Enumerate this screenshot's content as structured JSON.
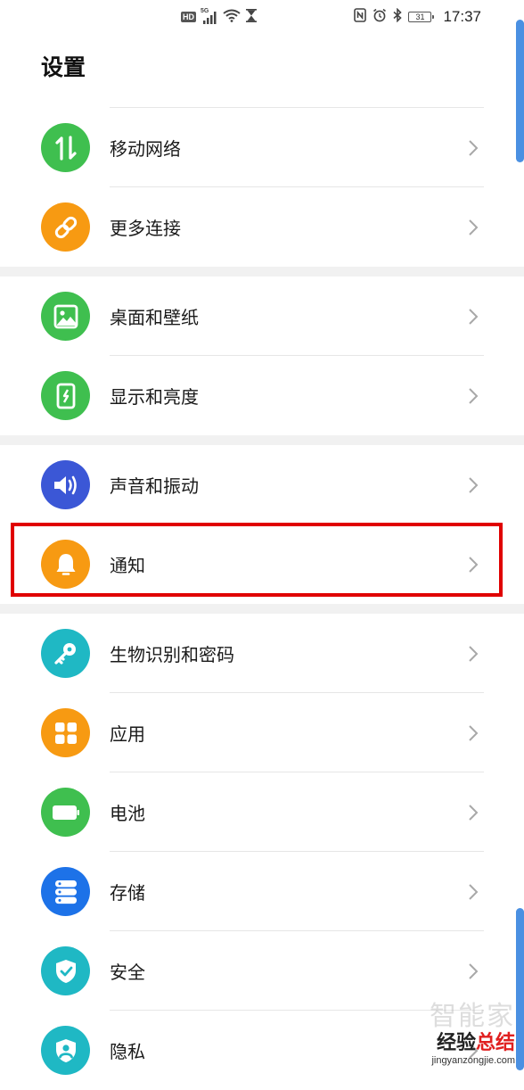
{
  "status_bar": {
    "left_icons": [
      "hd-icon",
      "signal-5g-icon",
      "wifi-icon",
      "hourglass-icon"
    ],
    "hd_label": "HD",
    "network_label": "5G",
    "right_icons": [
      "nfc-icon",
      "alarm-icon",
      "bluetooth-icon",
      "battery-icon"
    ],
    "battery_level": "31",
    "time": "17:37"
  },
  "page": {
    "title": "设置"
  },
  "groups": [
    {
      "items": [
        {
          "label": "移动网络",
          "icon": "mobile-network-icon",
          "color": "#3fbf4f"
        },
        {
          "label": "更多连接",
          "icon": "link-icon",
          "color": "#f79a12"
        }
      ]
    },
    {
      "items": [
        {
          "label": "桌面和壁纸",
          "icon": "wallpaper-icon",
          "color": "#3fbf4f"
        },
        {
          "label": "显示和亮度",
          "icon": "display-icon",
          "color": "#3fbf4f"
        }
      ]
    },
    {
      "items": [
        {
          "label": "声音和振动",
          "icon": "sound-icon",
          "color": "#3b57d6"
        },
        {
          "label": "通知",
          "icon": "bell-icon",
          "color": "#f79a12",
          "highlighted": true
        }
      ]
    },
    {
      "items": [
        {
          "label": "生物识别和密码",
          "icon": "key-icon",
          "color": "#1fb8c4"
        },
        {
          "label": "应用",
          "icon": "apps-icon",
          "color": "#f79a12"
        },
        {
          "label": "电池",
          "icon": "battery-icon",
          "color": "#3fbf4f"
        },
        {
          "label": "存储",
          "icon": "storage-icon",
          "color": "#1d72e8"
        },
        {
          "label": "安全",
          "icon": "shield-icon",
          "color": "#1fb8c4"
        },
        {
          "label": "隐私",
          "icon": "privacy-icon",
          "color": "#1fb8c4"
        }
      ]
    }
  ],
  "watermark": {
    "ghost_text": "智能家",
    "brand_prefix": "经验",
    "brand_accent": "总结",
    "url": "jingyanzongjie.com"
  },
  "colors": {
    "highlight_border": "#e00000",
    "scrollbar": "#4a90e2",
    "group_gap": "#f1f1f1"
  }
}
